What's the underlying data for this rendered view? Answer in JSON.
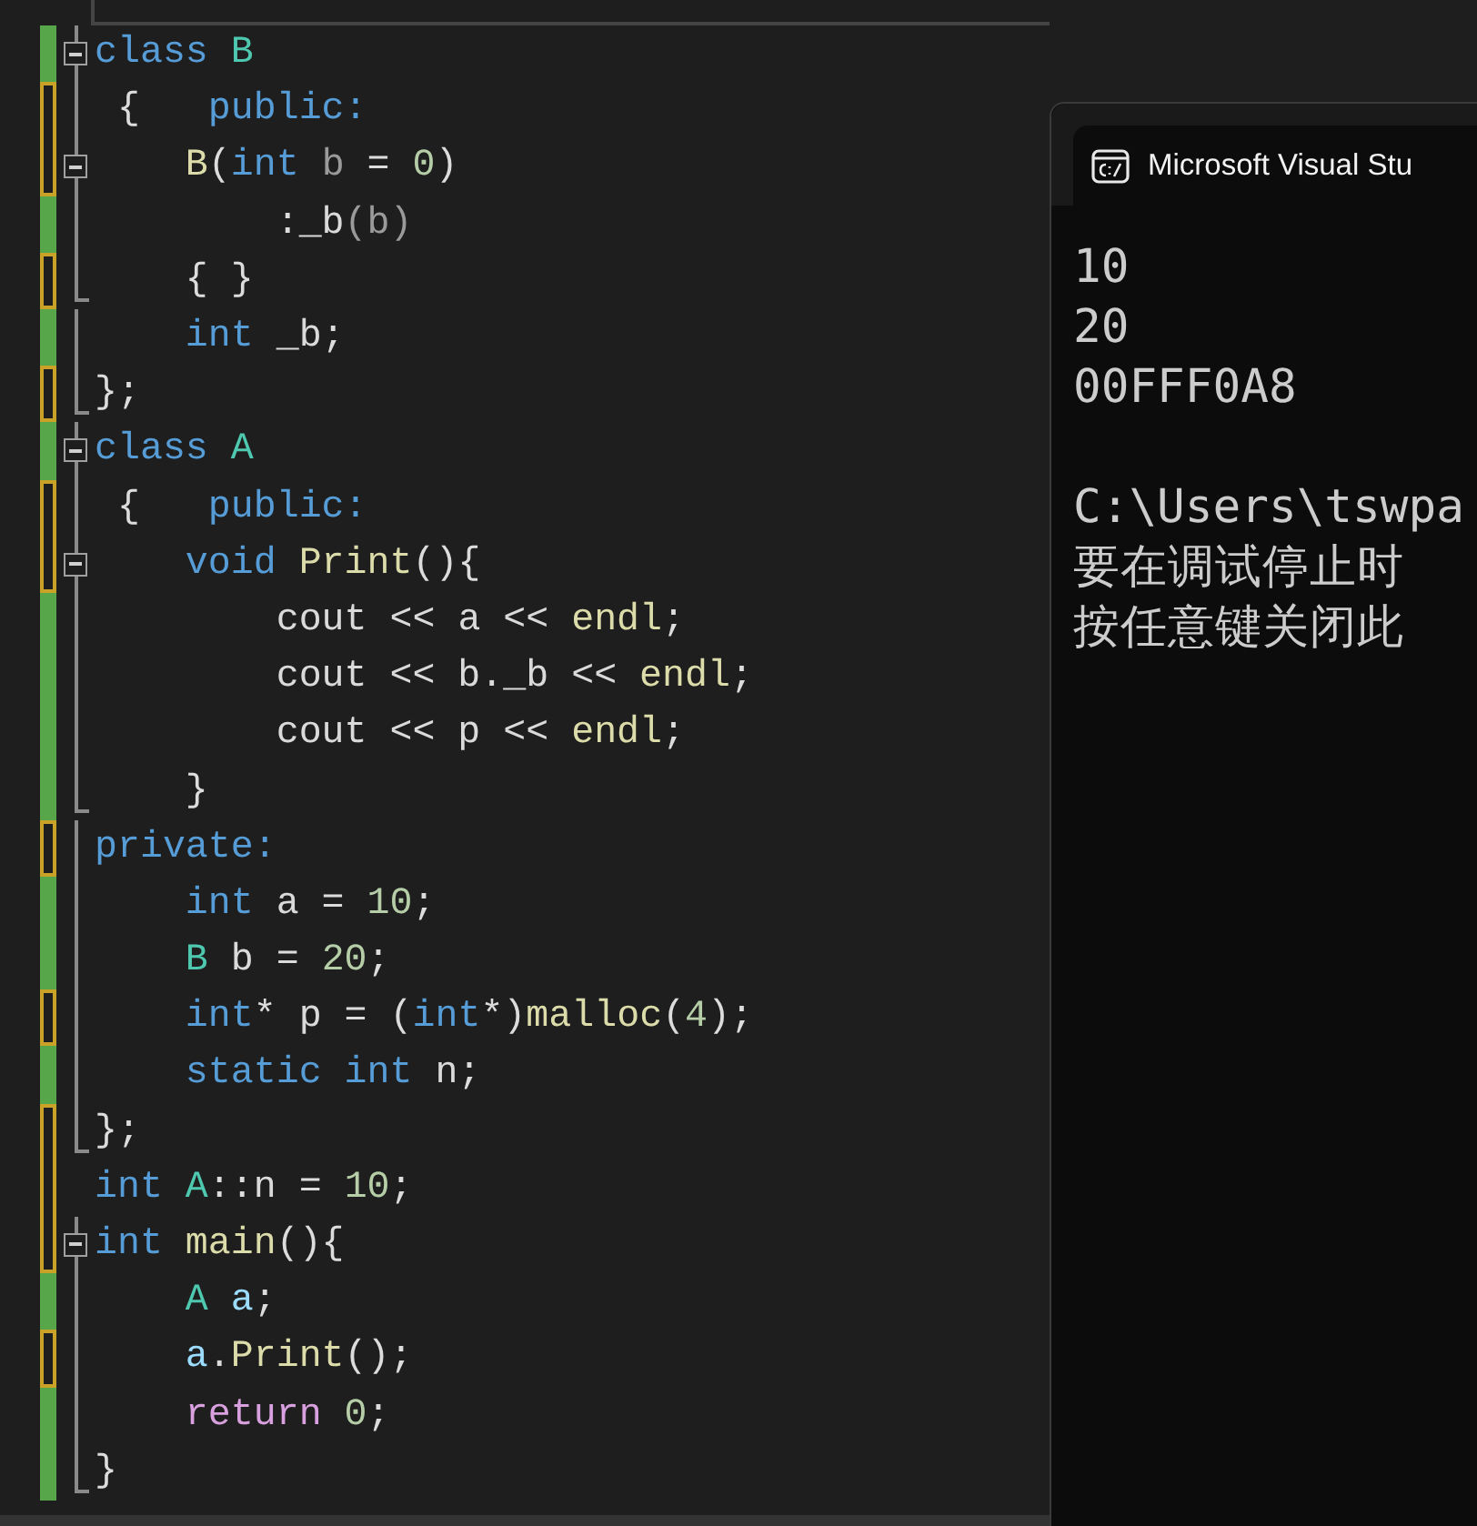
{
  "editor": {
    "lines": [
      {
        "unsaved": false,
        "collapsible": true,
        "in_block": true,
        "block_end": false,
        "tokens": [
          {
            "text": "class ",
            "kind": "kw"
          },
          {
            "text": "B",
            "kind": "type"
          }
        ]
      },
      {
        "unsaved": true,
        "collapsible": false,
        "in_block": true,
        "block_end": false,
        "tokens": [
          {
            "text": " {   ",
            "kind": "punct"
          },
          {
            "text": "public:",
            "kind": "kw"
          }
        ]
      },
      {
        "unsaved": true,
        "collapsible": true,
        "in_block": true,
        "block_end": false,
        "tokens": [
          {
            "text": "    B",
            "kind": "fn"
          },
          {
            "text": "(",
            "kind": "punct"
          },
          {
            "text": "int ",
            "kind": "kw"
          },
          {
            "text": "b",
            "kind": "param"
          },
          {
            "text": " = ",
            "kind": "punct"
          },
          {
            "text": "0",
            "kind": "num"
          },
          {
            "text": ")",
            "kind": "punct"
          }
        ]
      },
      {
        "unsaved": false,
        "collapsible": false,
        "in_block": true,
        "block_end": false,
        "tokens": [
          {
            "text": "        :",
            "kind": "punct"
          },
          {
            "text": "_b",
            "kind": "plain"
          },
          {
            "text": "(b)",
            "kind": "param"
          }
        ]
      },
      {
        "unsaved": true,
        "collapsible": false,
        "in_block": true,
        "block_end": true,
        "tokens": [
          {
            "text": "    { }",
            "kind": "punct"
          }
        ]
      },
      {
        "unsaved": false,
        "collapsible": false,
        "in_block": true,
        "block_end": false,
        "tokens": [
          {
            "text": "    int ",
            "kind": "kw"
          },
          {
            "text": "_b",
            "kind": "plain"
          },
          {
            "text": ";",
            "kind": "punct"
          }
        ]
      },
      {
        "unsaved": true,
        "collapsible": false,
        "in_block": true,
        "block_end": true,
        "tokens": [
          {
            "text": "};",
            "kind": "punct"
          }
        ]
      },
      {
        "unsaved": false,
        "collapsible": true,
        "in_block": true,
        "block_end": false,
        "tokens": [
          {
            "text": "class ",
            "kind": "kw"
          },
          {
            "text": "A",
            "kind": "type"
          }
        ]
      },
      {
        "unsaved": true,
        "collapsible": false,
        "in_block": true,
        "block_end": false,
        "tokens": [
          {
            "text": " {   ",
            "kind": "punct"
          },
          {
            "text": "public:",
            "kind": "kw"
          }
        ]
      },
      {
        "unsaved": true,
        "collapsible": true,
        "in_block": true,
        "block_end": false,
        "tokens": [
          {
            "text": "    void ",
            "kind": "kw"
          },
          {
            "text": "Print",
            "kind": "fn"
          },
          {
            "text": "(){",
            "kind": "punct"
          }
        ]
      },
      {
        "unsaved": false,
        "collapsible": false,
        "in_block": true,
        "block_end": false,
        "tokens": [
          {
            "text": "        cout << ",
            "kind": "plain"
          },
          {
            "text": "a",
            "kind": "plain"
          },
          {
            "text": " << ",
            "kind": "plain"
          },
          {
            "text": "endl",
            "kind": "fn"
          },
          {
            "text": ";",
            "kind": "punct"
          }
        ]
      },
      {
        "unsaved": false,
        "collapsible": false,
        "in_block": true,
        "block_end": false,
        "tokens": [
          {
            "text": "        cout << b._b << ",
            "kind": "plain"
          },
          {
            "text": "endl",
            "kind": "fn"
          },
          {
            "text": ";",
            "kind": "punct"
          }
        ]
      },
      {
        "unsaved": false,
        "collapsible": false,
        "in_block": true,
        "block_end": false,
        "tokens": [
          {
            "text": "        cout << p << ",
            "kind": "plain"
          },
          {
            "text": "endl",
            "kind": "fn"
          },
          {
            "text": ";",
            "kind": "punct"
          }
        ]
      },
      {
        "unsaved": false,
        "collapsible": false,
        "in_block": true,
        "block_end": true,
        "tokens": [
          {
            "text": "    }",
            "kind": "punct"
          }
        ]
      },
      {
        "unsaved": true,
        "collapsible": false,
        "in_block": true,
        "block_end": false,
        "tokens": [
          {
            "text": "private:",
            "kind": "kw"
          }
        ]
      },
      {
        "unsaved": false,
        "collapsible": false,
        "in_block": true,
        "block_end": false,
        "tokens": [
          {
            "text": "    int ",
            "kind": "kw"
          },
          {
            "text": "a",
            "kind": "plain"
          },
          {
            "text": " = ",
            "kind": "punct"
          },
          {
            "text": "10",
            "kind": "num"
          },
          {
            "text": ";",
            "kind": "punct"
          }
        ]
      },
      {
        "unsaved": false,
        "collapsible": false,
        "in_block": true,
        "block_end": false,
        "tokens": [
          {
            "text": "    B ",
            "kind": "type"
          },
          {
            "text": "b",
            "kind": "plain"
          },
          {
            "text": " = ",
            "kind": "punct"
          },
          {
            "text": "20",
            "kind": "num"
          },
          {
            "text": ";",
            "kind": "punct"
          }
        ]
      },
      {
        "unsaved": true,
        "collapsible": false,
        "in_block": true,
        "block_end": false,
        "tokens": [
          {
            "text": "    int",
            "kind": "kw"
          },
          {
            "text": "* ",
            "kind": "punct"
          },
          {
            "text": "p",
            "kind": "plain"
          },
          {
            "text": " = (",
            "kind": "punct"
          },
          {
            "text": "int",
            "kind": "kw"
          },
          {
            "text": "*)",
            "kind": "punct"
          },
          {
            "text": "malloc",
            "kind": "fn"
          },
          {
            "text": "(",
            "kind": "punct"
          },
          {
            "text": "4",
            "kind": "num"
          },
          {
            "text": ");",
            "kind": "punct"
          }
        ]
      },
      {
        "unsaved": false,
        "collapsible": false,
        "in_block": true,
        "block_end": false,
        "tokens": [
          {
            "text": "    static int ",
            "kind": "kw"
          },
          {
            "text": "n",
            "kind": "plain"
          },
          {
            "text": ";",
            "kind": "punct"
          }
        ]
      },
      {
        "unsaved": true,
        "collapsible": false,
        "in_block": true,
        "block_end": true,
        "tokens": [
          {
            "text": "};",
            "kind": "punct"
          }
        ]
      },
      {
        "unsaved": true,
        "collapsible": false,
        "in_block": false,
        "block_end": false,
        "tokens": [
          {
            "text": "int ",
            "kind": "kw"
          },
          {
            "text": "A",
            "kind": "type"
          },
          {
            "text": "::",
            "kind": "punct"
          },
          {
            "text": "n",
            "kind": "plain"
          },
          {
            "text": " = ",
            "kind": "punct"
          },
          {
            "text": "10",
            "kind": "num"
          },
          {
            "text": ";",
            "kind": "punct"
          }
        ]
      },
      {
        "unsaved": true,
        "collapsible": true,
        "in_block": true,
        "block_end": false,
        "tokens": [
          {
            "text": "int ",
            "kind": "kw"
          },
          {
            "text": "main",
            "kind": "fn"
          },
          {
            "text": "(){",
            "kind": "punct"
          }
        ]
      },
      {
        "unsaved": false,
        "collapsible": false,
        "in_block": true,
        "block_end": false,
        "tokens": [
          {
            "text": "    A ",
            "kind": "type"
          },
          {
            "text": "a",
            "kind": "var"
          },
          {
            "text": ";",
            "kind": "punct"
          }
        ]
      },
      {
        "unsaved": true,
        "collapsible": false,
        "in_block": true,
        "block_end": false,
        "tokens": [
          {
            "text": "    a",
            "kind": "var"
          },
          {
            "text": ".",
            "kind": "punct"
          },
          {
            "text": "Print",
            "kind": "fn"
          },
          {
            "text": "();",
            "kind": "punct"
          }
        ]
      },
      {
        "unsaved": false,
        "collapsible": false,
        "in_block": true,
        "block_end": false,
        "tokens": [
          {
            "text": "    return ",
            "kind": "ctrl"
          },
          {
            "text": "0",
            "kind": "num"
          },
          {
            "text": ";",
            "kind": "punct"
          }
        ]
      },
      {
        "unsaved": false,
        "collapsible": false,
        "in_block": true,
        "block_end": true,
        "tokens": [
          {
            "text": "}",
            "kind": "punct"
          }
        ]
      }
    ]
  },
  "console": {
    "title": "Microsoft Visual Stu",
    "blocks": [
      {
        "lines": [
          "10",
          "20",
          "00FFF0A8"
        ]
      },
      {
        "lines": [
          "C:\\Users\\tswpa",
          "要在调试停止时",
          "按任意键关闭此"
        ]
      }
    ]
  }
}
